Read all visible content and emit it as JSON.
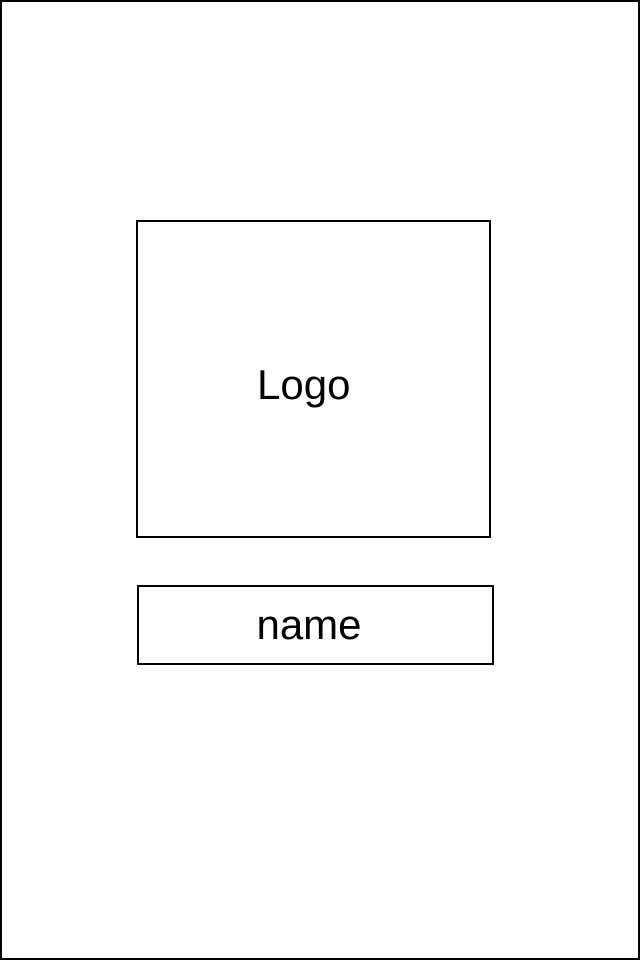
{
  "splash": {
    "logo_placeholder": "Logo",
    "name_placeholder": "name"
  }
}
